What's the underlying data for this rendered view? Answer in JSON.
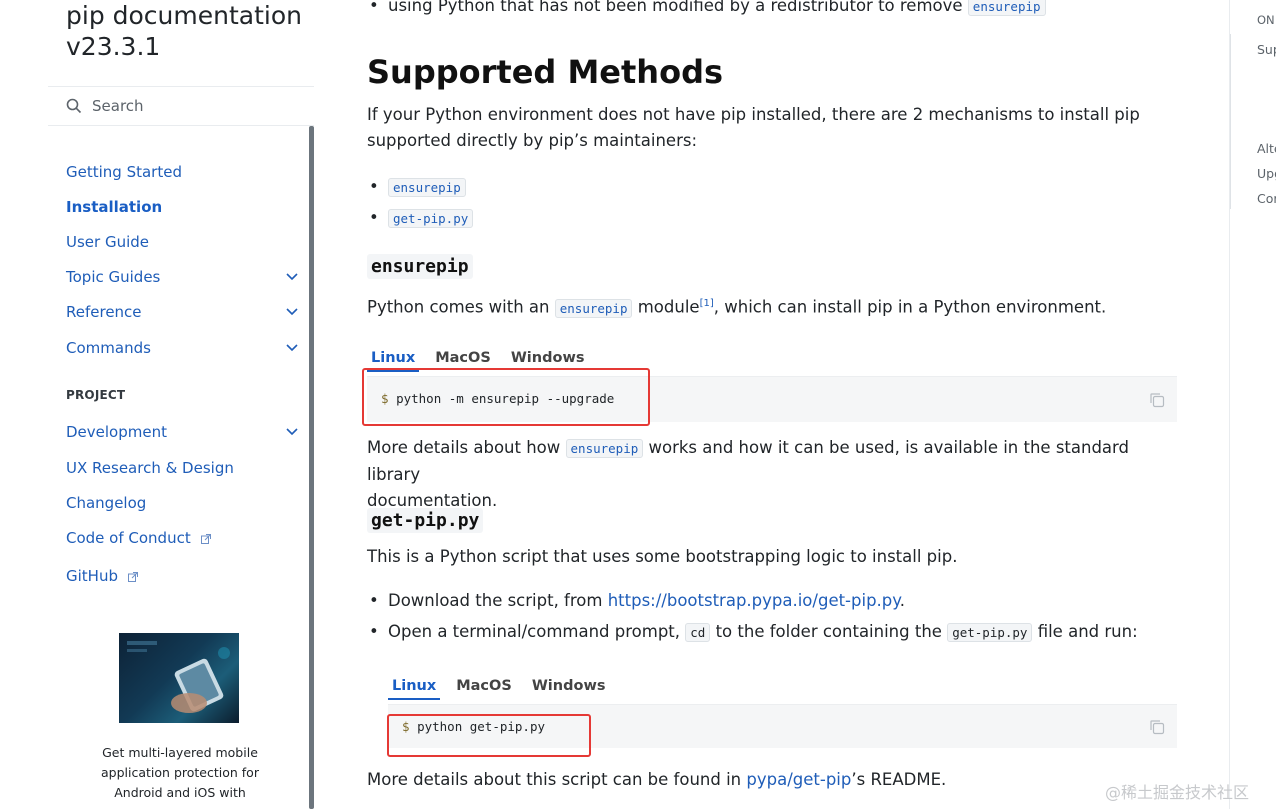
{
  "sidebar": {
    "site_title": "pip documentation v23.3.1",
    "search_placeholder": "Search",
    "nav": [
      {
        "label": "Getting Started"
      },
      {
        "label": "Installation"
      },
      {
        "label": "User Guide"
      },
      {
        "label": "Topic Guides"
      },
      {
        "label": "Reference"
      },
      {
        "label": "Commands"
      }
    ],
    "project_caption": "PROJECT",
    "project_nav": [
      {
        "label": "Development"
      },
      {
        "label": "UX Research & Design"
      },
      {
        "label": "Changelog"
      },
      {
        "label": "Code of Conduct"
      },
      {
        "label": "GitHub"
      }
    ],
    "ad_text": "Get multi-layered mobile application protection for Android and iOS with"
  },
  "main": {
    "top_bullet_text": "using Python that has not been modified by a redistributor to remove",
    "top_bullet_code": "ensurepip",
    "heading": "Supported Methods",
    "intro": "If your Python environment does not have pip installed, there are 2 mechanisms to install pip supported directly by pip’s maintainers:",
    "methods": [
      "ensurepip",
      "get-pip.py"
    ],
    "ensurepip": {
      "heading": "ensurepip",
      "para_before": "Python comes with an",
      "para_code": "ensurepip",
      "para_module": "module",
      "para_ref": "[1]",
      "para_after": ", which can install pip in a Python environment.",
      "tabs": [
        "Linux",
        "MacOS",
        "Windows"
      ],
      "command_prompt": "$",
      "command": "python -m ensurepip --upgrade",
      "more_before": "More details about how",
      "more_code": "ensurepip",
      "more_after": "works and how it can be used, is available in the standard library",
      "more_tail": "documentation."
    },
    "getpip": {
      "heading": "get-pip.py",
      "para": "This is a Python script that uses some bootstrapping logic to install pip.",
      "bullet1_before": "Download the script, from",
      "bullet1_link": "https://bootstrap.pypa.io/get-pip.py",
      "bullet1_after": ".",
      "bullet2_before": "Open a terminal/command prompt,",
      "bullet2_code1": "cd",
      "bullet2_mid": "to the folder containing the",
      "bullet2_code2": "get-pip.py",
      "bullet2_after": "file and run:",
      "tabs": [
        "Linux",
        "MacOS",
        "Windows"
      ],
      "command_prompt": "$",
      "command": "python get-pip.py",
      "more_before": "More details about this script can be found in",
      "more_link": "pypa/get-pip",
      "more_after": "’s README."
    }
  },
  "toc": {
    "caption": "ON",
    "items": [
      "Sup",
      "Alte",
      "Upg",
      "Cor"
    ]
  },
  "watermark": "@稀土掘金技术社区",
  "colors": {
    "link": "#1f5db8",
    "highlight_box": "#e53935"
  }
}
